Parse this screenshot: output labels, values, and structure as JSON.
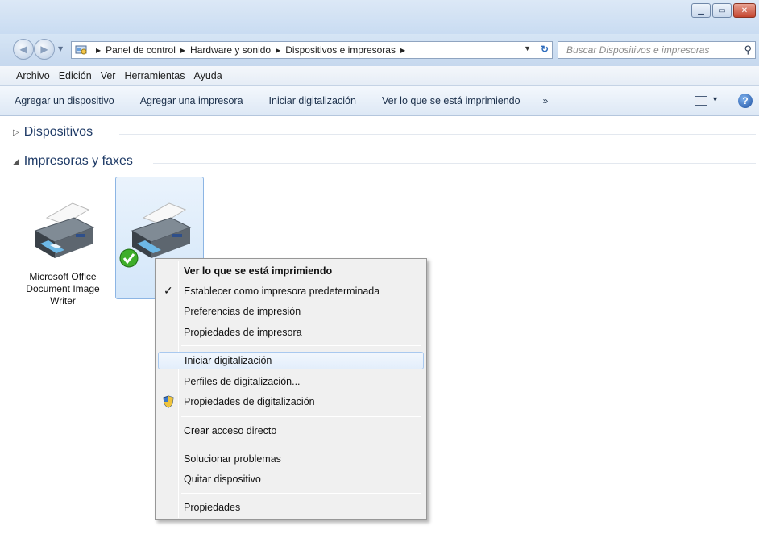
{
  "window": {
    "minimize_icon": "minimize-icon",
    "maximize_icon": "maximize-icon",
    "close_icon": "close-icon"
  },
  "address": {
    "crumbs": [
      "Panel de control",
      "Hardware y sonido",
      "Dispositivos e impresoras"
    ]
  },
  "search": {
    "placeholder": "Buscar Dispositivos e impresoras"
  },
  "menubar": {
    "items": [
      "Archivo",
      "Edición",
      "Ver",
      "Herramientas",
      "Ayuda"
    ]
  },
  "commandbar": {
    "items": [
      "Agregar un dispositivo",
      "Agregar una impresora",
      "Iniciar digitalización",
      "Ver lo que se está imprimiendo"
    ],
    "more": "»"
  },
  "groups": {
    "devices": "Dispositivos",
    "printers": "Impresoras y faxes"
  },
  "printers": [
    {
      "name_line1": "Microsoft Office",
      "name_line2": "Document Image",
      "name_line3": "Writer",
      "selected": false
    },
    {
      "name_line1": "",
      "selected": true,
      "default": true
    }
  ],
  "context_menu": {
    "items": [
      "Ver lo que se está imprimiendo",
      "Establecer como impresora predeterminada",
      "Preferencias de impresión",
      "Propiedades de impresora",
      "Iniciar digitalización",
      "Perfiles de digitalización...",
      "Propiedades de digitalización",
      "Crear acceso directo",
      "Solucionar problemas",
      "Quitar dispositivo",
      "Propiedades"
    ],
    "check_mark": "✓"
  }
}
